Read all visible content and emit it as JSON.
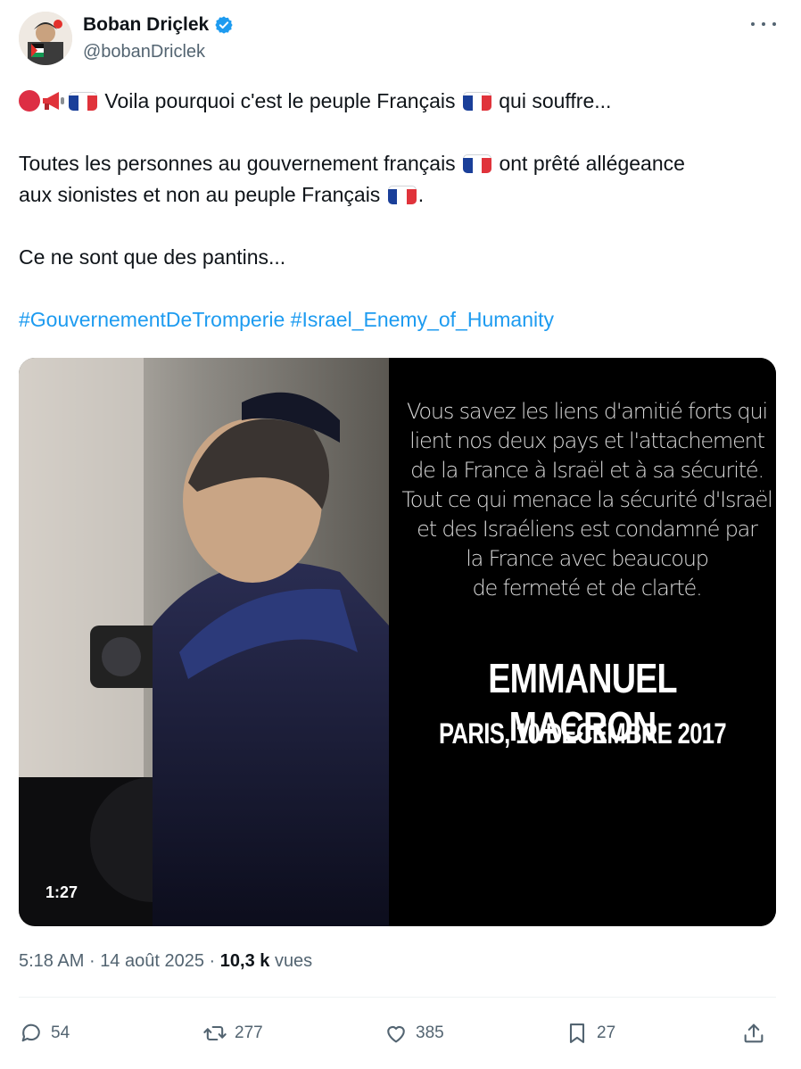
{
  "author": {
    "display_name": "Boban Driçlek",
    "handle": "@bobanDriclek",
    "verified": true
  },
  "tweet": {
    "line1": "Voila pourquoi c'est le peuple Français",
    "line1_end": "qui souffre...",
    "line2a": "Toutes les personnes au gouvernement français",
    "line2b": "ont prêté allégeance",
    "line3": "aux sionistes et non au peuple Français",
    "line3_end": ".",
    "line4": "Ce ne sont que des pantins...",
    "hashtags": [
      "#GouvernementDeTromperie",
      "#Israel_Enemy_of_Humanity"
    ]
  },
  "media": {
    "quote": "Vous savez les liens d'amitié forts qui lient nos deux pays et l'attachement de la France à Israël et à sa sécurité. Tout ce qui menace la sécurité d'Israël et des Israéliens est condamné par la France avec beaucoup de fermeté et de clarté.",
    "quote_lines": [
      "Vous savez les liens d'amitié forts qui",
      "lient nos deux pays et l'attachement",
      "de la France à Israël et à sa sécurité.",
      "Tout ce qui menace la sécurité d'Israël",
      "et des Israéliens est condamné par",
      "la France avec beaucoup",
      "de fermeté et de clarté."
    ],
    "speaker": "EMMANUEL MACRON",
    "date_place": "PARIS, 10 DECEMBRE 2017",
    "duration": "1:27"
  },
  "meta": {
    "time": "5:18 AM",
    "date": "14 août 2025",
    "views_count": "10,3 k",
    "views_label": "vues",
    "separator": "·"
  },
  "actions": {
    "replies": "54",
    "reposts": "277",
    "likes": "385",
    "bookmarks": "27"
  },
  "colors": {
    "accent": "#1d9bf0",
    "secondary_text": "#536471",
    "flag_blue": "#1a3f99",
    "flag_red": "#e0333b"
  }
}
